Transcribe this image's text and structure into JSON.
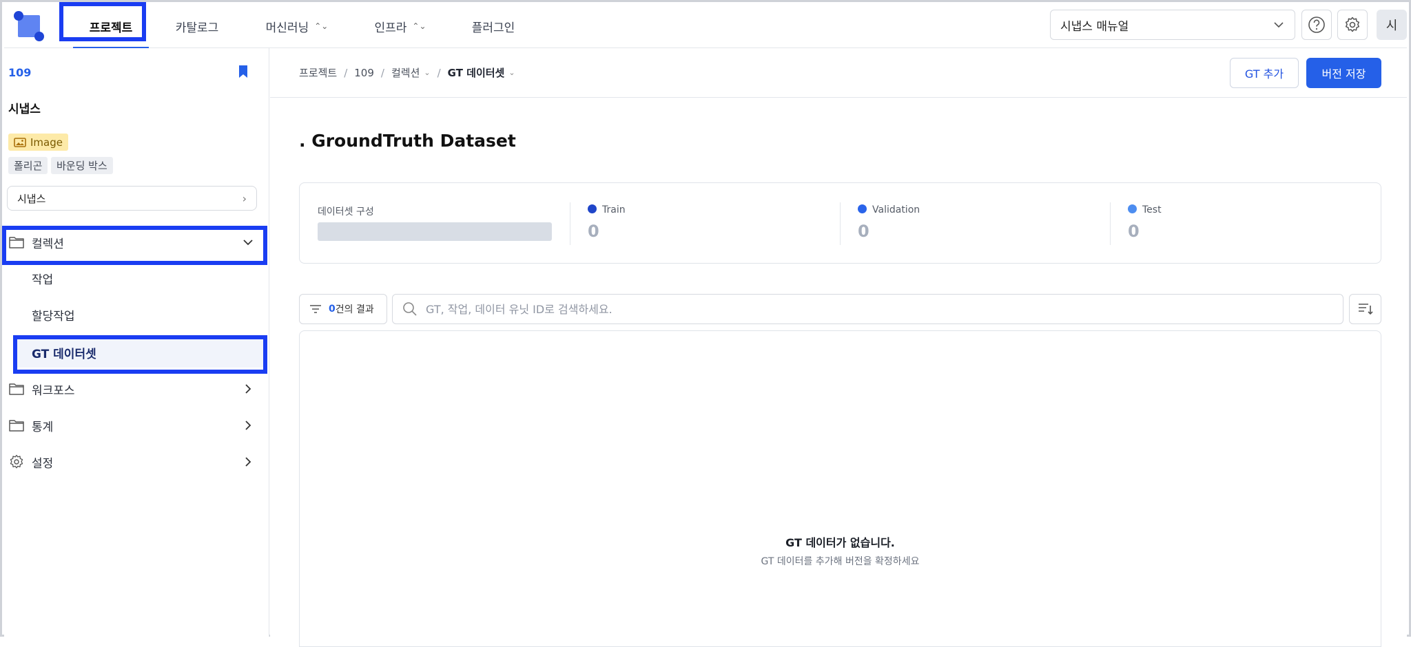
{
  "topnav": {
    "tabs": [
      {
        "label": "프로젝트",
        "active": true,
        "has_dropdown": false
      },
      {
        "label": "카탈로그",
        "active": false,
        "has_dropdown": false
      },
      {
        "label": "머신러닝",
        "active": false,
        "has_dropdown": true
      },
      {
        "label": "인프라",
        "active": false,
        "has_dropdown": true
      },
      {
        "label": "플러그인",
        "active": false,
        "has_dropdown": false
      }
    ],
    "manual_select_value": "시냅스 매뉴얼",
    "avatar_initial": "시",
    "icons": [
      "help-icon",
      "gear-icon"
    ]
  },
  "sidebar": {
    "project_id": "109",
    "project_name": "시냅스",
    "data_type_badge": "Image",
    "tags": [
      "폴리곤",
      "바운딩 박스"
    ],
    "project_select_value": "시냅스",
    "sections": [
      {
        "label": "컬렉션",
        "icon": "folder-icon",
        "expanded": true
      },
      {
        "label": "워크포스",
        "icon": "folder-icon",
        "expanded": false
      },
      {
        "label": "통계",
        "icon": "folder-icon",
        "expanded": false
      },
      {
        "label": "설정",
        "icon": "gear-icon",
        "expanded": false
      }
    ],
    "collection_items": [
      "작업",
      "할당작업",
      "GT 데이터셋"
    ],
    "selected_item": "GT 데이터셋"
  },
  "breadcrumb": [
    "프로젝트",
    "109",
    "컬렉션",
    "GT 데이터셋"
  ],
  "actions": {
    "add_gt": "GT 추가",
    "save_version": "버전 저장"
  },
  "page_title": ". GroundTruth Dataset",
  "stats": {
    "composition_label": "데이터셋 구성",
    "splits": [
      {
        "label": "Train",
        "value": "0",
        "color": "#1f45c9"
      },
      {
        "label": "Validation",
        "value": "0",
        "color": "#2a64ea"
      },
      {
        "label": "Test",
        "value": "0",
        "color": "#4d8df0"
      }
    ]
  },
  "filter": {
    "count": "0",
    "count_suffix": "건의 결과"
  },
  "search": {
    "placeholder": "GT, 작업, 데이터 유닛 ID로 검색하세요."
  },
  "empty": {
    "title": "GT 데이터가 없습니다.",
    "subtitle": "GT 데이터를 추가해 버전을 확정하세요"
  }
}
